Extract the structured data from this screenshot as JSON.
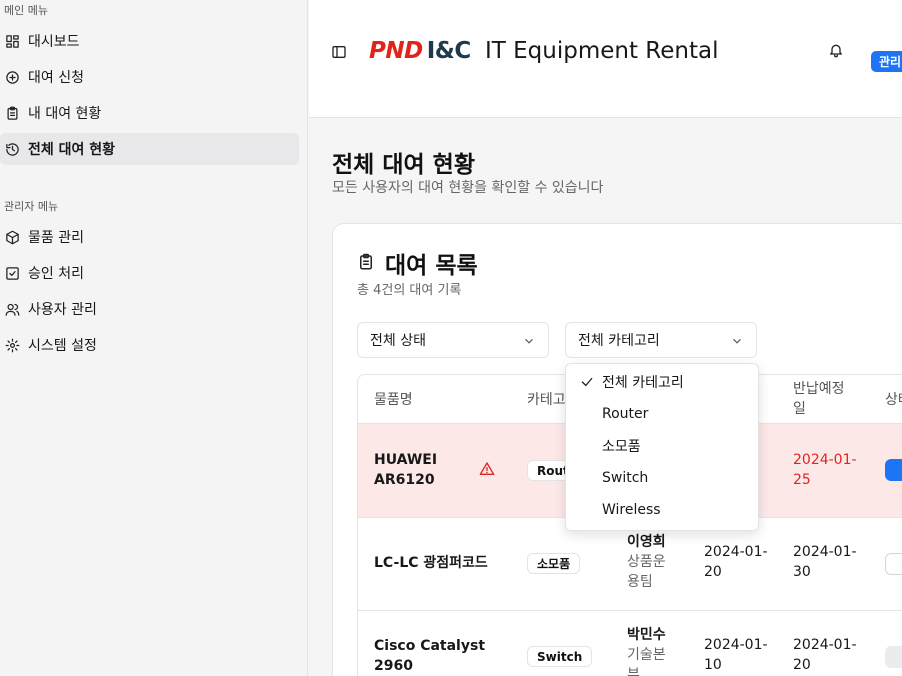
{
  "sidebar": {
    "main_title": "메인 메뉴",
    "main_items": [
      {
        "label": "대시보드",
        "icon": "dashboard-icon"
      },
      {
        "label": "대여 신청",
        "icon": "plus-circle-icon"
      },
      {
        "label": "내 대여 현황",
        "icon": "clipboard-icon"
      },
      {
        "label": "전체 대여 현황",
        "icon": "history-icon",
        "active": true
      }
    ],
    "admin_title": "관리자 메뉴",
    "admin_items": [
      {
        "label": "물품 관리",
        "icon": "package-icon"
      },
      {
        "label": "승인 처리",
        "icon": "check-square-icon"
      },
      {
        "label": "사용자 관리",
        "icon": "users-icon"
      },
      {
        "label": "시스템 설정",
        "icon": "gear-icon"
      }
    ]
  },
  "header": {
    "logo_pnd": "PND",
    "logo_ic": "I&C",
    "title": "IT Equipment Rental",
    "badge": "관리"
  },
  "page": {
    "title": "전체 대여 현황",
    "subtitle": "모든 사용자의 대여 현황을 확인할 수 있습니다"
  },
  "card": {
    "title": "대여 목록",
    "subtitle": "총 4건의 대여 기록"
  },
  "filters": {
    "status_value": "전체 상태",
    "category_value": "전체 카테고리",
    "category_options": [
      "전체 카테고리",
      "Router",
      "소모품",
      "Switch",
      "Wireless"
    ],
    "category_selected_index": 0
  },
  "table": {
    "headers": {
      "name": "물품명",
      "category": "카테고",
      "due_line1": "반납예정",
      "due_line2": "일",
      "status": "상태"
    },
    "rows": [
      {
        "name1": "HUAWEI",
        "name2": "AR6120",
        "category": "Router",
        "user": "",
        "dept1": "",
        "dept2": "",
        "start1": "",
        "start2": "",
        "due1": "2024-01-",
        "due2": "25",
        "overdue": true
      },
      {
        "name1": "LC-LC 광점퍼코드",
        "name2": "",
        "category": "소모품",
        "user": "이영희",
        "dept1": "상품운",
        "dept2": "용팀",
        "start1": "2024-01-",
        "start2": "20",
        "due1": "2024-01-",
        "due2": "30",
        "overdue": false
      },
      {
        "name1": "Cisco Catalyst",
        "name2": "2960",
        "category": "Switch",
        "user": "박민수",
        "dept1": "기술본",
        "dept2": "부",
        "start1": "2024-01-",
        "start2": "10",
        "due1": "2024-01-",
        "due2": "20",
        "overdue": false
      }
    ]
  },
  "colors": {
    "accent": "#1d74f5",
    "danger": "#e02424",
    "overdue_row": "#fde8e8",
    "logo_red": "#e2231a",
    "logo_navy": "#1f3a4d"
  }
}
